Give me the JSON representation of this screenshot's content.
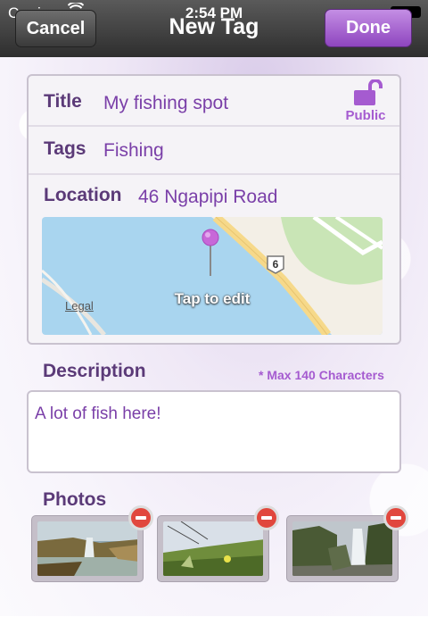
{
  "status": {
    "carrier": "Carrier",
    "time": "2:54 PM"
  },
  "nav": {
    "cancel": "Cancel",
    "title": "New Tag",
    "done": "Done"
  },
  "form": {
    "title_label": "Title",
    "title_value": "My fishing spot",
    "privacy": "Public",
    "tags_label": "Tags",
    "tags_value": "Fishing",
    "location_label": "Location",
    "location_value": "46 Ngapipi Road",
    "map_overlay": "Tap to edit",
    "map_legal": "Legal",
    "map_road_marker": "6"
  },
  "description": {
    "label": "Description",
    "limit_note": "* Max 140 Characters",
    "value": "A lot of fish here!"
  },
  "photos": {
    "label": "Photos",
    "items": [
      {
        "name": "waterfall-river"
      },
      {
        "name": "grass-slope"
      },
      {
        "name": "waterfall-cliff"
      }
    ]
  },
  "colors": {
    "accent": "#a55bd0",
    "label": "#5b3a78",
    "value": "#7a3fa8",
    "remove": "#e1473d"
  }
}
